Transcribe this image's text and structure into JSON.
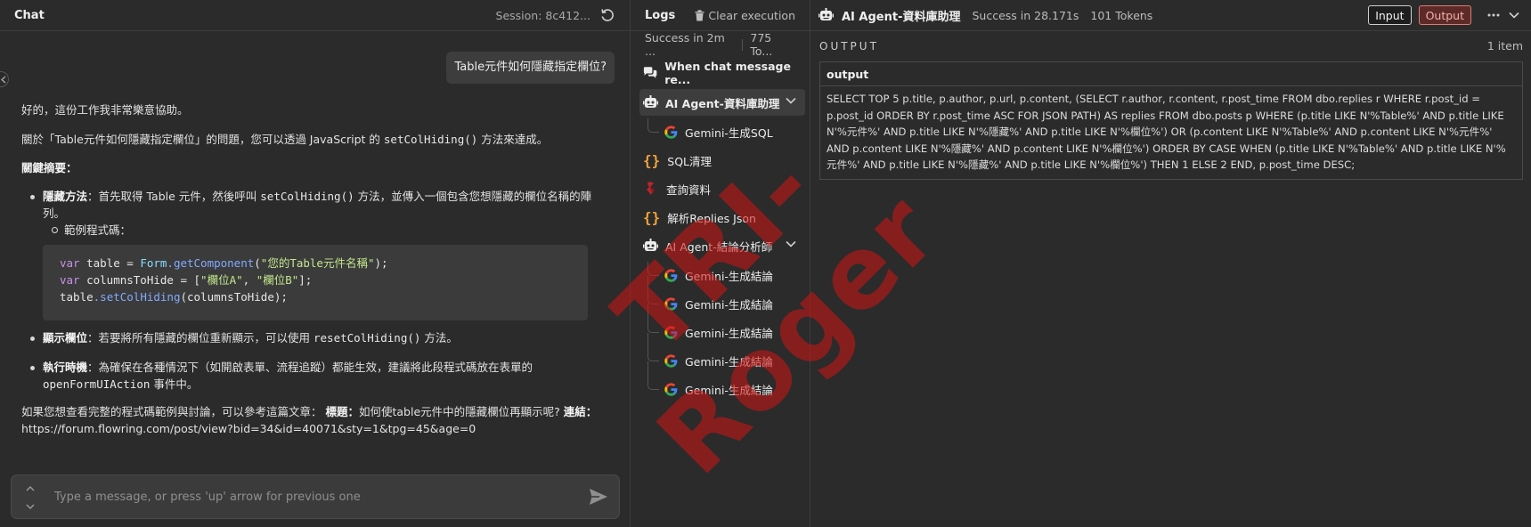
{
  "chat": {
    "title": "Chat",
    "session": "Session: 8c412...",
    "user_message": "Table元件如何隱藏指定欄位?",
    "bot": {
      "greeting": "好的，這份工作我非常樂意協助。",
      "intro_prefix": "關於「Table元件如何隱藏指定欄位」的問題，您可以透過 JavaScript 的 ",
      "intro_code": "setColHiding()",
      "intro_suffix": " 方法來達成。",
      "summary_heading": "關鍵摘要：",
      "hide_label": "隱藏方法",
      "hide_text_a": "：首先取得 Table 元件，然後呼叫 ",
      "hide_code": "setColHiding()",
      "hide_text_b": " 方法，並傳入一個包含您想隱藏的欄位名稱的陣列。",
      "example_label": "範例程式碼：",
      "code_lines": {
        "l1_kw": "var",
        "l1_var": " table = ",
        "l1_obj": "Form",
        "l1_fn": ".getComponent",
        "l1_open": "(",
        "l1_str": "\"您的Table元件名稱\"",
        "l1_close": ");",
        "l2_kw": "var",
        "l2_var": " columnsToHide = [",
        "l2_str1": "\"欄位A\"",
        "l2_sep": ", ",
        "l2_str2": "\"欄位B\"",
        "l2_close": "];",
        "l3_var": "table",
        "l3_fn": ".setColHiding",
        "l3_rest": "(columnsToHide);"
      },
      "show_label": "顯示欄位",
      "show_text": "：若要將所有隱藏的欄位重新顯示，可以使用 ",
      "show_code": "resetColHiding()",
      "show_suffix": " 方法。",
      "timing_label": "執行時機",
      "timing_text": "：為確保在各種情況下（如開啟表單、流程追蹤）都能生效，建議將此段程式碼放在表單的 ",
      "timing_code": "openFormUIAction",
      "timing_suffix": " 事件中。",
      "outro_a": "如果您想查看完整的程式碼範例與討論，可以參考這篇文章： ",
      "outro_title_label": "標題：",
      "outro_title": "如何使table元件中的隱藏欄位再顯示呢? ",
      "outro_link_label": "連結：",
      "outro_link": "https://forum.flowring.com/post/view?bid=34&id=40071&sty=1&tpg=45&age=0"
    },
    "composer_placeholder": "Type a message, or press 'up' arrow for previous one"
  },
  "logs": {
    "title": "Logs",
    "clear_label": "Clear execution",
    "status": "Success in 2m ...",
    "tokens": "775 To...",
    "items": [
      {
        "label": "When chat message re..."
      },
      {
        "label": "AI Agent-資料庫助理"
      },
      {
        "label": "Gemini-生成SQL"
      },
      {
        "label": "SQL清理"
      },
      {
        "label": "查詢資料"
      },
      {
        "label": "解析Replies Json"
      },
      {
        "label": "AI Agent-結論分析師"
      },
      {
        "label": "Gemini-生成結論"
      },
      {
        "label": "Gemini-生成結論"
      },
      {
        "label": "Gemini-生成結論"
      },
      {
        "label": "Gemini-生成結論"
      },
      {
        "label": "Gemini-生成結論"
      }
    ]
  },
  "output": {
    "title": "AI Agent-資料庫助理",
    "status": "Success in 28.171s",
    "tokens": "101 Tokens",
    "input_btn": "Input",
    "output_btn": "Output",
    "section_label": "OUTPUT",
    "count": "1 item",
    "column": "output",
    "value": "SELECT TOP 5 p.title, p.author, p.url, p.content, (SELECT r.author, r.content, r.post_time FROM dbo.replies r WHERE r.post_id = p.post_id ORDER BY r.post_time ASC FOR JSON PATH) AS replies FROM dbo.posts p WHERE (p.title LIKE N'%Table%' AND p.title LIKE N'%元件%' AND p.title LIKE N'%隱藏%' AND p.title LIKE N'%欄位%') OR (p.content LIKE N'%Table%' AND p.content LIKE N'%元件%' AND p.content LIKE N'%隱藏%' AND p.content LIKE N'%欄位%') ORDER BY CASE WHEN (p.title LIKE N'%Table%' AND p.title LIKE N'%元件%' AND p.title LIKE N'%隱藏%' AND p.title LIKE N'%欄位%') THEN 1 ELSE 2 END, p.post_time DESC;"
  },
  "watermark": "TRI-Roger",
  "colors": {
    "background": "#2b2b2b",
    "output_accent": "#d87c74",
    "watermark": "#d21414",
    "google_blue": "#4285f4",
    "google_red": "#ea4335",
    "google_yellow": "#fbbc05",
    "google_green": "#34a853"
  }
}
